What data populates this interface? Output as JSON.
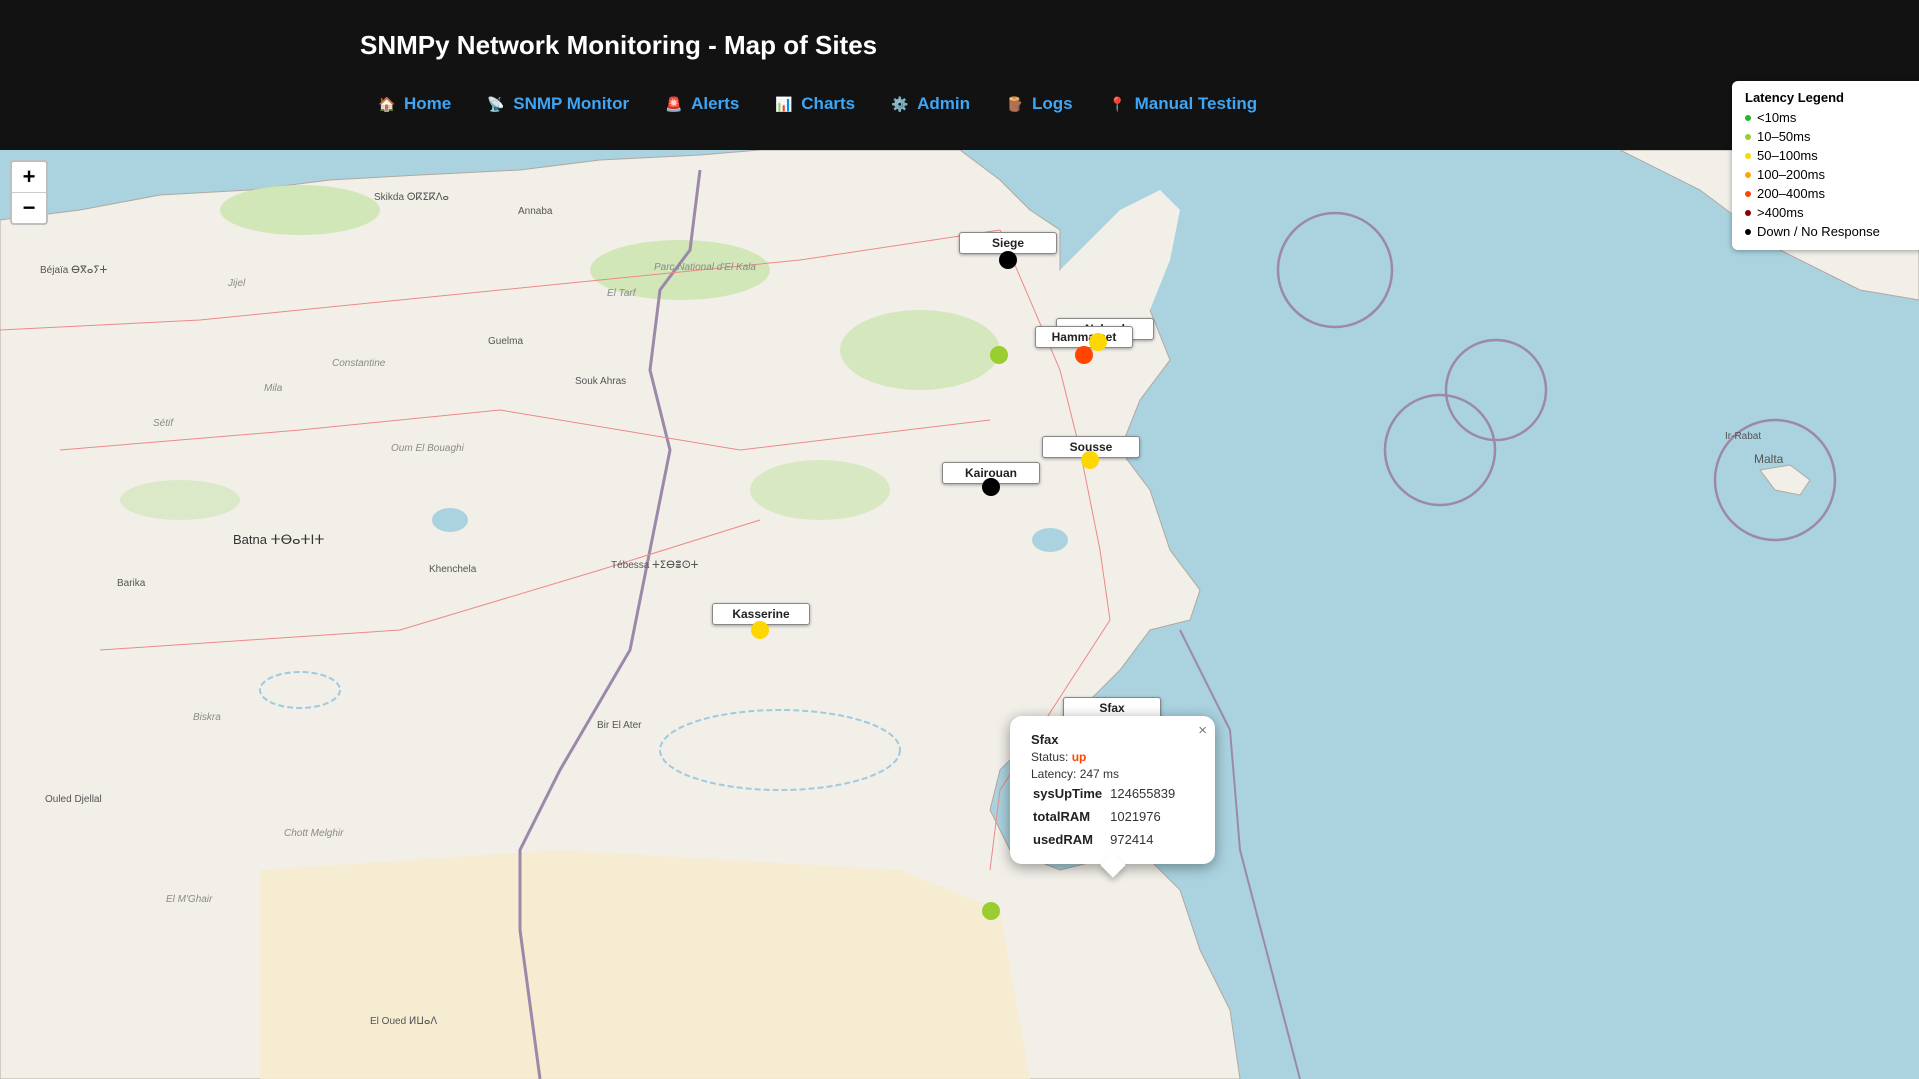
{
  "header": {
    "title": "SNMPy Network Monitoring - Map of Sites",
    "nav": [
      {
        "label": "Home",
        "icon": "🏠"
      },
      {
        "label": "SNMP Monitor",
        "icon": "📡"
      },
      {
        "label": "Alerts",
        "icon": "🚨"
      },
      {
        "label": "Charts",
        "icon": "📊"
      },
      {
        "label": "Admin",
        "icon": "⚙️"
      },
      {
        "label": "Logs",
        "icon": "🪵"
      },
      {
        "label": "Manual Testing",
        "icon": "📍"
      }
    ]
  },
  "zoom": {
    "in": "+",
    "out": "−"
  },
  "legend": {
    "title": "Latency Legend",
    "items": [
      {
        "label": "<10ms",
        "color": "#22b822"
      },
      {
        "label": "10–50ms",
        "color": "#9acd32"
      },
      {
        "label": "50–100ms",
        "color": "#ffd700"
      },
      {
        "label": "100–200ms",
        "color": "#ffa500"
      },
      {
        "label": "200–400ms",
        "color": "#ff4500"
      },
      {
        "label": ">400ms",
        "color": "#8b0000"
      },
      {
        "label": "Down / No Response",
        "color": "#000000"
      }
    ]
  },
  "sites": [
    {
      "name": "Siege",
      "color": "#000000"
    },
    {
      "name": "Nabeul",
      "color": "#ffd700"
    },
    {
      "name": "Hammamet",
      "color": "#ff4500"
    },
    {
      "name": "Sousse",
      "color": "#ffd700"
    },
    {
      "name": "Kairouan",
      "color": "#000000"
    },
    {
      "name": "Kasserine",
      "color": "#ffd700"
    },
    {
      "name": "Sfax",
      "color": "#ff4500"
    }
  ],
  "unlabeled_markers": [
    {
      "color": "#9acd32"
    },
    {
      "color": "#9acd32"
    }
  ],
  "popup": {
    "name": "Sfax",
    "status_label": "Status:",
    "status_value": "up",
    "status_color": "#ff4500",
    "latency": "Latency: 247 ms",
    "close": "×",
    "metrics": [
      {
        "key": "sysUpTime",
        "value": "124655839"
      },
      {
        "key": "totalRAM",
        "value": "1021976"
      },
      {
        "key": "usedRAM",
        "value": "972414"
      }
    ]
  },
  "map_labels": [
    "Skikda ⵙⴽⵉⴽⴷⴰ",
    "Annaba",
    "Béjaïa ⴱⴳⴰⵢⵜ",
    "Jijel",
    "Guelma",
    "Constantine",
    "Souk Ahras",
    "Sétif",
    "Mila",
    "Oum El Bouaghi",
    "Batna ⵜⴱⴰⵜⵏⵜ",
    "Khenchela",
    "Tébessa ⵜⵉⴱⴻⵙⵜ",
    "Barika",
    "Biskra",
    "Bir El Ater",
    "Ouled Djellal",
    "El M'Ghair",
    "El Oued ⵍⵡⴰⴷ",
    "Chott Melghir",
    "Ir-Rabat",
    "Malta",
    "El Tarf",
    "Parc National d'El Kala"
  ]
}
